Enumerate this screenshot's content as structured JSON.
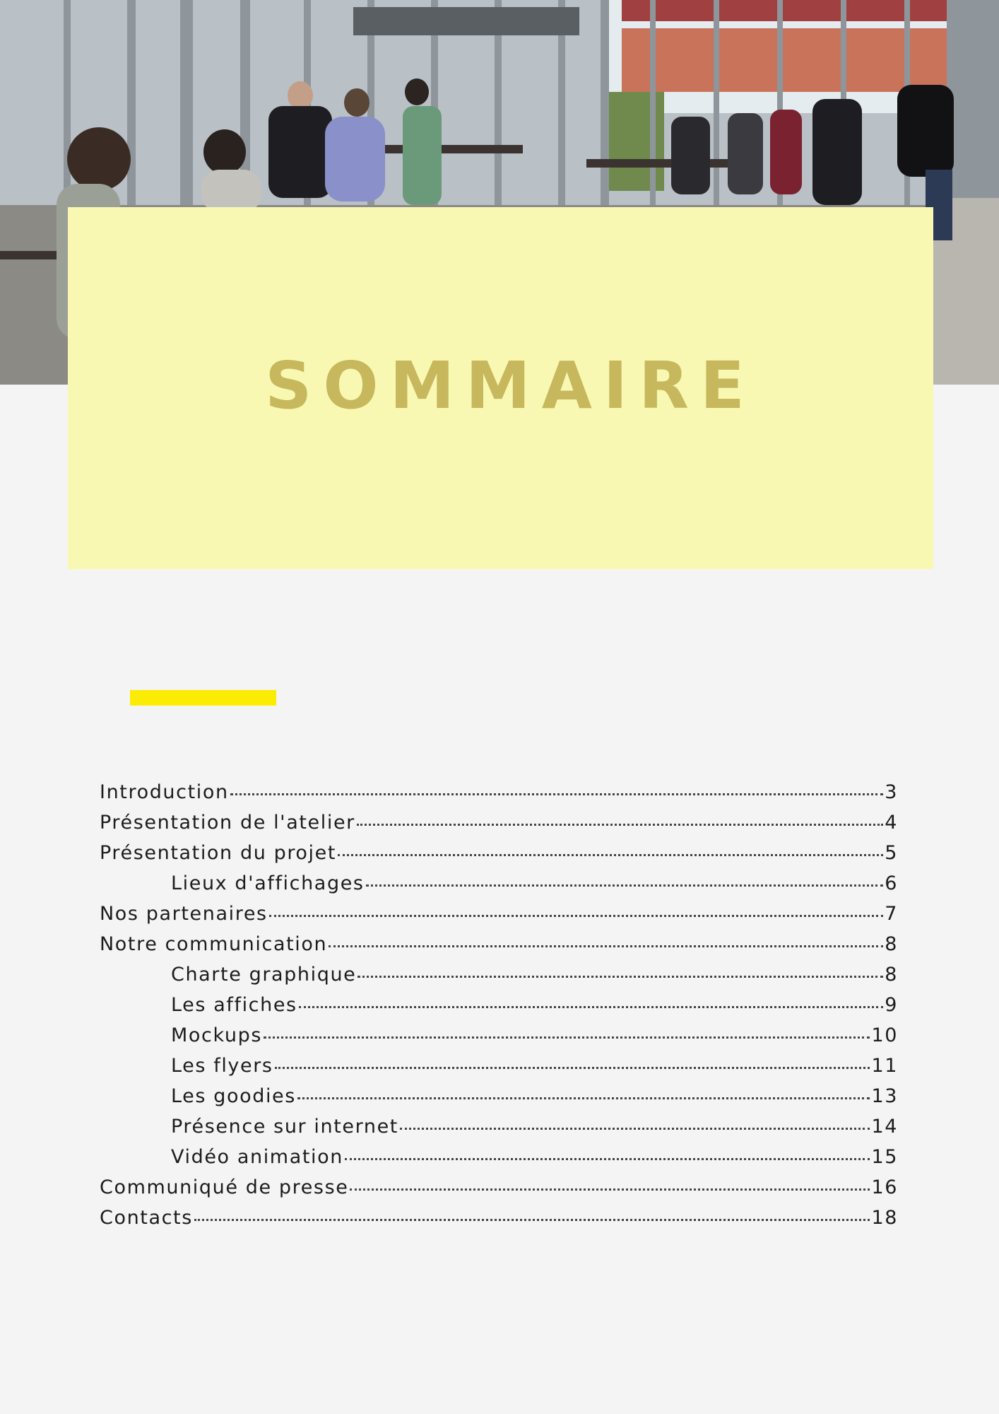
{
  "header": {
    "photo_icon": "workshop-photo",
    "title": "SOMMAIRE"
  },
  "colors": {
    "title_box": "#f8f8b2",
    "title_text": "#c7b75d",
    "accent_bar": "#fcec04",
    "page_bg": "#f4f4f4"
  },
  "toc": [
    {
      "label": "Introduction",
      "page": "3",
      "level": 0
    },
    {
      "label": "Présentation de l'atelier",
      "page": "4",
      "level": 0
    },
    {
      "label": "Présentation du projet",
      "page": "5",
      "level": 0
    },
    {
      "label": "Lieux d'affichages",
      "page": "6",
      "level": 1
    },
    {
      "label": "Nos partenaires",
      "page": "7",
      "level": 0
    },
    {
      "label": "Notre communication",
      "page": "8",
      "level": 0
    },
    {
      "label": "Charte graphique",
      "page": "8",
      "level": 1
    },
    {
      "label": "Les affiches",
      "page": "9",
      "level": 1
    },
    {
      "label": "Mockups",
      "page": "10",
      "level": 1
    },
    {
      "label": "Les flyers",
      "page": "11",
      "level": 1
    },
    {
      "label": "Les goodies",
      "page": "13",
      "level": 1
    },
    {
      "label": "Présence sur internet",
      "page": "14",
      "level": 1
    },
    {
      "label": "Vidéo animation",
      "page": "15",
      "level": 1
    },
    {
      "label": "Communiqué de presse",
      "page": "16",
      "level": 0
    },
    {
      "label": "Contacts",
      "page": "18",
      "level": 0
    }
  ]
}
